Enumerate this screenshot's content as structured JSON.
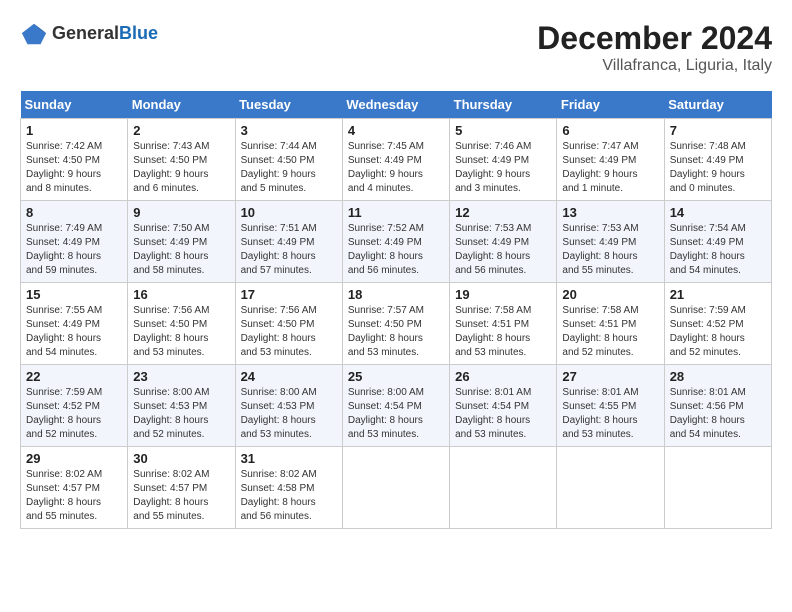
{
  "logo": {
    "general": "General",
    "blue": "Blue"
  },
  "header": {
    "month": "December 2024",
    "location": "Villafranca, Liguria, Italy"
  },
  "days_of_week": [
    "Sunday",
    "Monday",
    "Tuesday",
    "Wednesday",
    "Thursday",
    "Friday",
    "Saturday"
  ],
  "weeks": [
    [
      {
        "day": "1",
        "info": "Sunrise: 7:42 AM\nSunset: 4:50 PM\nDaylight: 9 hours\nand 8 minutes."
      },
      {
        "day": "2",
        "info": "Sunrise: 7:43 AM\nSunset: 4:50 PM\nDaylight: 9 hours\nand 6 minutes."
      },
      {
        "day": "3",
        "info": "Sunrise: 7:44 AM\nSunset: 4:50 PM\nDaylight: 9 hours\nand 5 minutes."
      },
      {
        "day": "4",
        "info": "Sunrise: 7:45 AM\nSunset: 4:49 PM\nDaylight: 9 hours\nand 4 minutes."
      },
      {
        "day": "5",
        "info": "Sunrise: 7:46 AM\nSunset: 4:49 PM\nDaylight: 9 hours\nand 3 minutes."
      },
      {
        "day": "6",
        "info": "Sunrise: 7:47 AM\nSunset: 4:49 PM\nDaylight: 9 hours\nand 1 minute."
      },
      {
        "day": "7",
        "info": "Sunrise: 7:48 AM\nSunset: 4:49 PM\nDaylight: 9 hours\nand 0 minutes."
      }
    ],
    [
      {
        "day": "8",
        "info": "Sunrise: 7:49 AM\nSunset: 4:49 PM\nDaylight: 8 hours\nand 59 minutes."
      },
      {
        "day": "9",
        "info": "Sunrise: 7:50 AM\nSunset: 4:49 PM\nDaylight: 8 hours\nand 58 minutes."
      },
      {
        "day": "10",
        "info": "Sunrise: 7:51 AM\nSunset: 4:49 PM\nDaylight: 8 hours\nand 57 minutes."
      },
      {
        "day": "11",
        "info": "Sunrise: 7:52 AM\nSunset: 4:49 PM\nDaylight: 8 hours\nand 56 minutes."
      },
      {
        "day": "12",
        "info": "Sunrise: 7:53 AM\nSunset: 4:49 PM\nDaylight: 8 hours\nand 56 minutes."
      },
      {
        "day": "13",
        "info": "Sunrise: 7:53 AM\nSunset: 4:49 PM\nDaylight: 8 hours\nand 55 minutes."
      },
      {
        "day": "14",
        "info": "Sunrise: 7:54 AM\nSunset: 4:49 PM\nDaylight: 8 hours\nand 54 minutes."
      }
    ],
    [
      {
        "day": "15",
        "info": "Sunrise: 7:55 AM\nSunset: 4:49 PM\nDaylight: 8 hours\nand 54 minutes."
      },
      {
        "day": "16",
        "info": "Sunrise: 7:56 AM\nSunset: 4:50 PM\nDaylight: 8 hours\nand 53 minutes."
      },
      {
        "day": "17",
        "info": "Sunrise: 7:56 AM\nSunset: 4:50 PM\nDaylight: 8 hours\nand 53 minutes."
      },
      {
        "day": "18",
        "info": "Sunrise: 7:57 AM\nSunset: 4:50 PM\nDaylight: 8 hours\nand 53 minutes."
      },
      {
        "day": "19",
        "info": "Sunrise: 7:58 AM\nSunset: 4:51 PM\nDaylight: 8 hours\nand 53 minutes."
      },
      {
        "day": "20",
        "info": "Sunrise: 7:58 AM\nSunset: 4:51 PM\nDaylight: 8 hours\nand 52 minutes."
      },
      {
        "day": "21",
        "info": "Sunrise: 7:59 AM\nSunset: 4:52 PM\nDaylight: 8 hours\nand 52 minutes."
      }
    ],
    [
      {
        "day": "22",
        "info": "Sunrise: 7:59 AM\nSunset: 4:52 PM\nDaylight: 8 hours\nand 52 minutes."
      },
      {
        "day": "23",
        "info": "Sunrise: 8:00 AM\nSunset: 4:53 PM\nDaylight: 8 hours\nand 52 minutes."
      },
      {
        "day": "24",
        "info": "Sunrise: 8:00 AM\nSunset: 4:53 PM\nDaylight: 8 hours\nand 53 minutes."
      },
      {
        "day": "25",
        "info": "Sunrise: 8:00 AM\nSunset: 4:54 PM\nDaylight: 8 hours\nand 53 minutes."
      },
      {
        "day": "26",
        "info": "Sunrise: 8:01 AM\nSunset: 4:54 PM\nDaylight: 8 hours\nand 53 minutes."
      },
      {
        "day": "27",
        "info": "Sunrise: 8:01 AM\nSunset: 4:55 PM\nDaylight: 8 hours\nand 53 minutes."
      },
      {
        "day": "28",
        "info": "Sunrise: 8:01 AM\nSunset: 4:56 PM\nDaylight: 8 hours\nand 54 minutes."
      }
    ],
    [
      {
        "day": "29",
        "info": "Sunrise: 8:02 AM\nSunset: 4:57 PM\nDaylight: 8 hours\nand 55 minutes."
      },
      {
        "day": "30",
        "info": "Sunrise: 8:02 AM\nSunset: 4:57 PM\nDaylight: 8 hours\nand 55 minutes."
      },
      {
        "day": "31",
        "info": "Sunrise: 8:02 AM\nSunset: 4:58 PM\nDaylight: 8 hours\nand 56 minutes."
      },
      null,
      null,
      null,
      null
    ]
  ]
}
